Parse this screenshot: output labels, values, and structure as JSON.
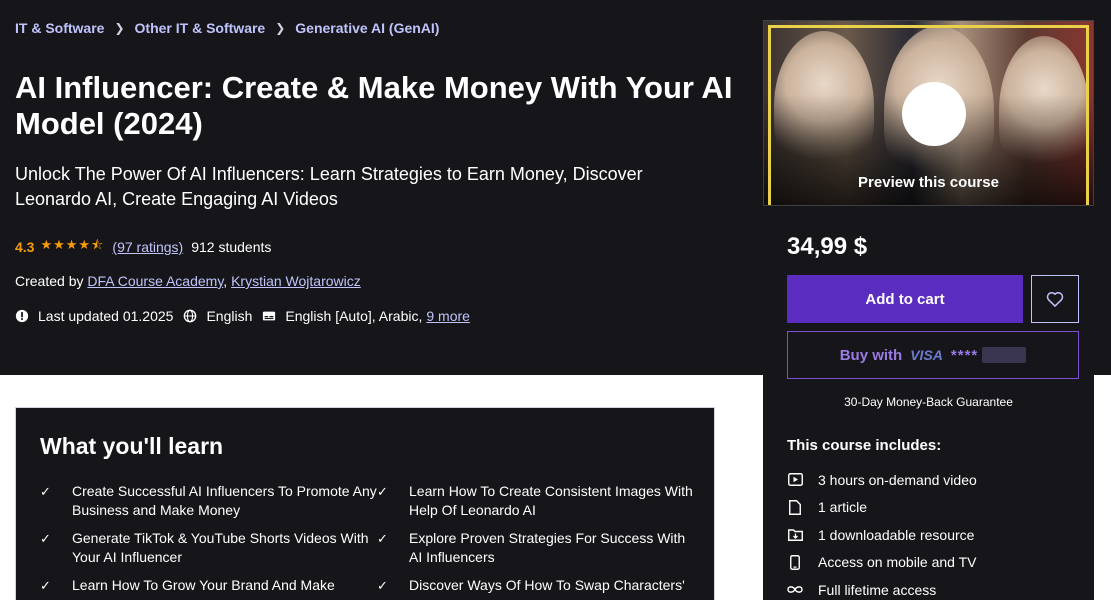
{
  "breadcrumb": [
    "IT & Software",
    "Other IT & Software",
    "Generative AI (GenAI)"
  ],
  "course": {
    "title": "AI Influencer: Create & Make Money With Your AI Model (2024)",
    "subtitle": "Unlock The Power Of AI Influencers: Learn Strategies to Earn Money, Discover Leonardo AI, Create Engaging AI Videos",
    "rating": "4.3",
    "ratings_count": "(97 ratings)",
    "students": "912 students",
    "created_by_label": "Created by",
    "authors": [
      "DFA Course Academy",
      "Krystian Wojtarowicz"
    ],
    "last_updated": "Last updated 01.2025",
    "language": "English",
    "captions": "English [Auto], Arabic,",
    "captions_more": "9 more"
  },
  "sidebar": {
    "preview_label": "Preview this course",
    "price": "34,99 $",
    "add_to_cart": "Add to cart",
    "buy_with": "Buy with",
    "card_brand": "VISA",
    "card_mask": "****",
    "guarantee": "30-Day Money-Back Guarantee",
    "includes_title": "This course includes:",
    "includes": [
      {
        "icon": "video-icon",
        "text": "3 hours on-demand video"
      },
      {
        "icon": "article-icon",
        "text": "1 article"
      },
      {
        "icon": "download-icon",
        "text": "1 downloadable resource"
      },
      {
        "icon": "mobile-icon",
        "text": "Access on mobile and TV"
      },
      {
        "icon": "infinity-icon",
        "text": "Full lifetime access"
      }
    ]
  },
  "learn": {
    "title": "What you'll learn",
    "items": [
      "Create Successful AI Influencers To Promote Any Business and Make Money",
      "Learn How To Create Consistent Images With Help Of Leonardo AI",
      "Generate TikTok & YouTube Shorts Videos With Your AI Influencer",
      "Explore Proven Strategies For Success With AI Influencers",
      "Learn How To Grow Your Brand And Make",
      "Discover Ways Of How To Swap Characters'"
    ]
  },
  "colors": {
    "background": "#16161a",
    "accent": "#5b2cc0",
    "link": "#c0c4fc",
    "star": "#f69c08"
  }
}
